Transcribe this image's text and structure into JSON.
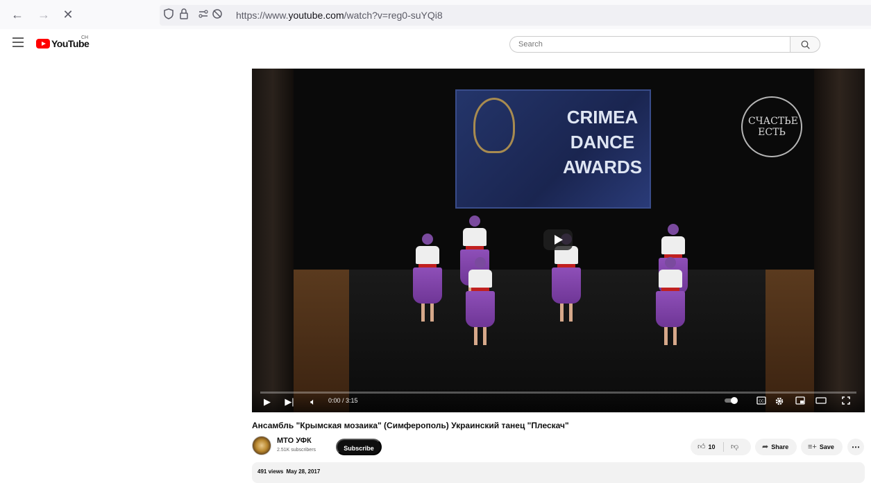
{
  "browser": {
    "back_icon": "←",
    "forward_icon": "→",
    "stop_icon": "✕",
    "url_prefix": "https://www.",
    "url_domain": "youtube.com",
    "url_path": "/watch?v=reg0-suYQi8"
  },
  "masthead": {
    "logo_text": "YouTube",
    "region": "CH",
    "search_placeholder": "Search"
  },
  "player": {
    "banner_title": "CRIMEA DANCE AWARDS",
    "watermark_text": "СЧАСТЬЕ ЕСТЬ",
    "time": "0:00 / 3:15",
    "progress": 0
  },
  "video": {
    "title": "Ансамбль \"Крымская мозаика\" (Симферополь) Украинский танец \"Плескач\"",
    "channel_name": "МТО УФК",
    "channel_subs": "2.51K subscribers",
    "subscribe_label": "Subscribe",
    "likes": "10",
    "share_label": "Share",
    "save_label": "Save",
    "more_label": "⋯",
    "views": "491 views",
    "date": "May 28, 2017"
  },
  "colors": {
    "brand_red": "#ff0000",
    "text_primary": "#0f0f0f",
    "pill_bg": "#f2f2f2"
  }
}
